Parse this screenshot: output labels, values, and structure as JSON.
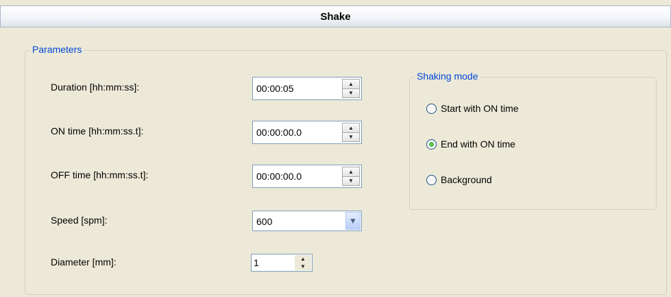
{
  "title": "Shake",
  "parameters": {
    "legend": "Parameters",
    "duration": {
      "label": "Duration [hh:mm:ss]:",
      "value": "00:00:05"
    },
    "on_time": {
      "label": "ON time [hh:mm:ss.t]:",
      "value": "00:00:00.0"
    },
    "off_time": {
      "label": "OFF time [hh:mm:ss.t]:",
      "value": "00:00:00.0"
    },
    "speed": {
      "label": "Speed [spm]:",
      "value": "600"
    },
    "diameter": {
      "label": "Diameter [mm]:",
      "value": "1"
    }
  },
  "shaking_mode": {
    "legend": "Shaking mode",
    "options": [
      {
        "label": "Start with ON time",
        "selected": false
      },
      {
        "label": "End with ON time",
        "selected": true
      },
      {
        "label": "Background",
        "selected": false
      }
    ]
  }
}
